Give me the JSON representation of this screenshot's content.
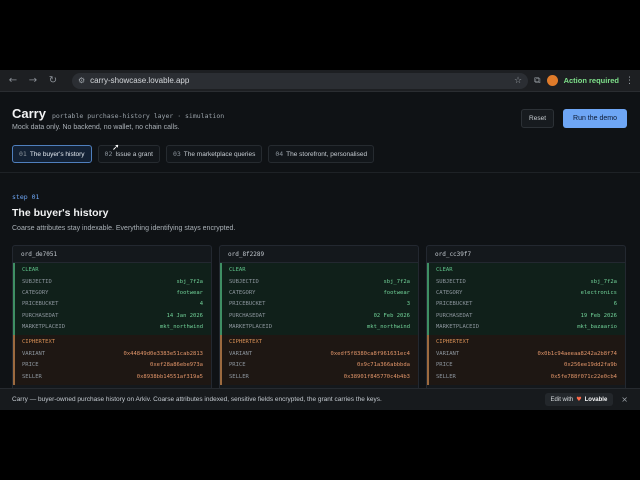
{
  "browser": {
    "url": "carry-showcase.lovable.app",
    "action_label": "Action required",
    "icons": [
      "back-icon",
      "forward-icon",
      "reload-icon",
      "tune-icon",
      "star-icon",
      "extensions-icon",
      "profile-icon",
      "kebab-icon"
    ]
  },
  "header": {
    "title": "Carry",
    "subtitle": "portable purchase-history layer · simulation",
    "note": "Mock data only. No backend, no wallet, no chain calls.",
    "reset_label": "Reset",
    "run_label": "Run the demo"
  },
  "steps": [
    {
      "num": "01",
      "label": "The buyer's history",
      "active": true
    },
    {
      "num": "02",
      "label": "Issue a grant",
      "active": false
    },
    {
      "num": "03",
      "label": "The marketplace queries",
      "active": false
    },
    {
      "num": "04",
      "label": "The storefront, personalised",
      "active": false
    }
  ],
  "section": {
    "step_label": "step 01",
    "heading": "The buyer's history",
    "description": "Coarse attributes stay indexable. Everything identifying stays encrypted."
  },
  "cards": [
    {
      "id": "ord_de7051",
      "clear_title": "CLEAR",
      "clear": [
        {
          "k": "SUBJECTID",
          "v": "sbj_7f2a"
        },
        {
          "k": "CATEGORY",
          "v": "footwear"
        },
        {
          "k": "PRICEBUCKET",
          "v": "4"
        },
        {
          "k": "PURCHASEDAT",
          "v": "14 Jan 2026"
        },
        {
          "k": "MARKETPLACEID",
          "v": "mkt_northwind"
        }
      ],
      "cipher_title": "CIPHERTEXT",
      "cipher": [
        {
          "k": "VARIANT",
          "v": "0x44849d0e3383e51cab2813"
        },
        {
          "k": "PRICE",
          "v": "0xef28a86ebe973a"
        },
        {
          "k": "SELLER",
          "v": "0x8938bb14551af319a5"
        }
      ]
    },
    {
      "id": "ord_8f2289",
      "clear_title": "CLEAR",
      "clear": [
        {
          "k": "SUBJECTID",
          "v": "sbj_7f2a"
        },
        {
          "k": "CATEGORY",
          "v": "footwear"
        },
        {
          "k": "PRICEBUCKET",
          "v": "3"
        },
        {
          "k": "PURCHASEDAT",
          "v": "02 Feb 2026"
        },
        {
          "k": "MARKETPLACEID",
          "v": "mkt_northwind"
        }
      ],
      "cipher_title": "CIPHERTEXT",
      "cipher": [
        {
          "k": "VARIANT",
          "v": "0xedf5f8380ca8f961631ec4"
        },
        {
          "k": "PRICE",
          "v": "0x9c71a366abbbda"
        },
        {
          "k": "SELLER",
          "v": "0x38901f845770c4b4b3"
        }
      ]
    },
    {
      "id": "ord_cc39f7",
      "clear_title": "CLEAR",
      "clear": [
        {
          "k": "SUBJECTID",
          "v": "sbj_7f2a"
        },
        {
          "k": "CATEGORY",
          "v": "electronics"
        },
        {
          "k": "PRICEBUCKET",
          "v": "6"
        },
        {
          "k": "PURCHASEDAT",
          "v": "19 Feb 2026"
        },
        {
          "k": "MARKETPLACEID",
          "v": "mkt_bazaario"
        }
      ],
      "cipher_title": "CIPHERTEXT",
      "cipher": [
        {
          "k": "VARIANT",
          "v": "0x0b1c94aeeaa8242a2b8f74"
        },
        {
          "k": "PRICE",
          "v": "0x256ee19dd2fa9b"
        },
        {
          "k": "SELLER",
          "v": "0x5fe788f071c22e0cb4"
        }
      ]
    }
  ],
  "footer": {
    "text": "Carry — buyer-owned purchase history on Arkiv. Coarse attributes indexed, sensitive fields encrypted, the grant carries the keys.",
    "edit_with": "Edit with",
    "brand": "Lovable"
  }
}
